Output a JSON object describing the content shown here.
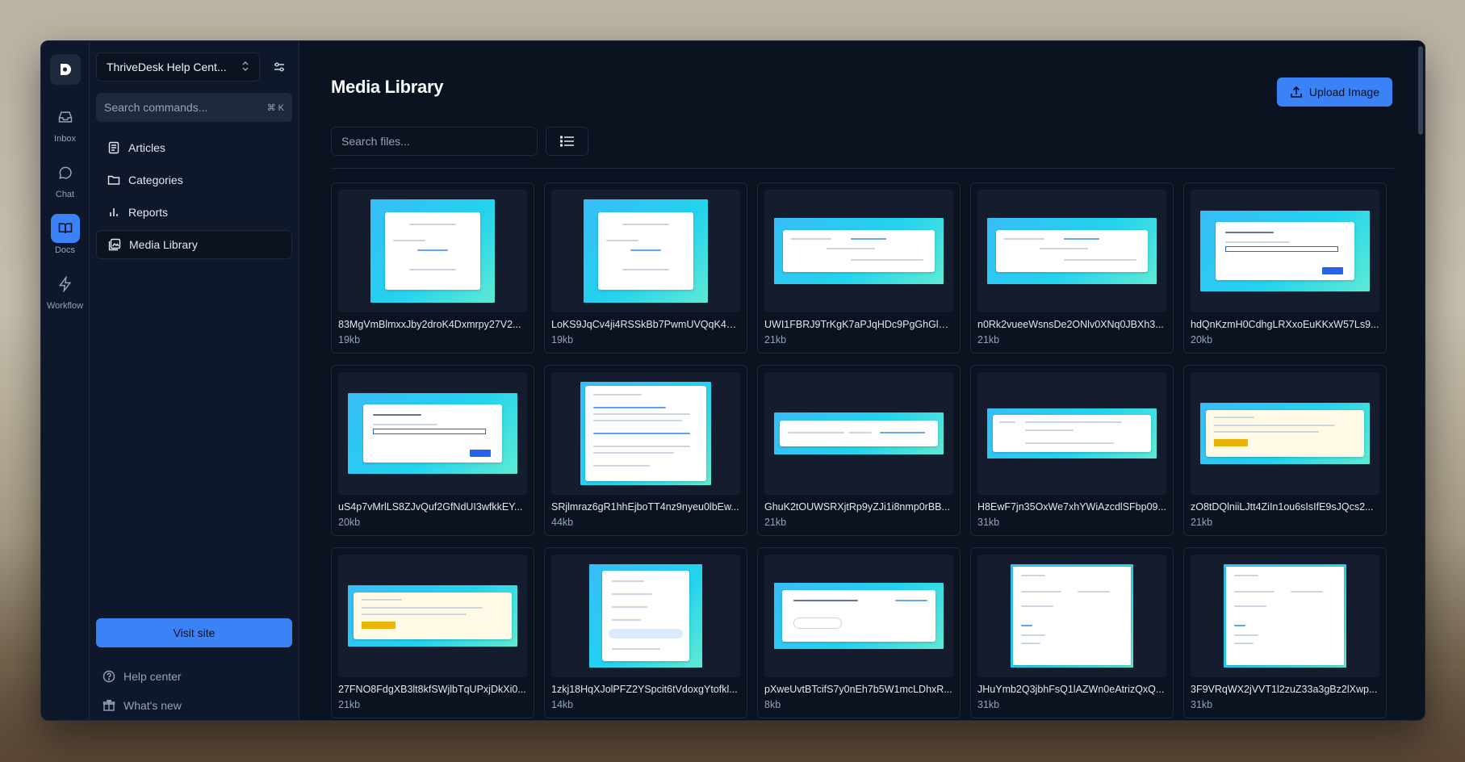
{
  "workspace": {
    "name": "ThriveDesk Help Cent..."
  },
  "rail": [
    {
      "label": "Inbox",
      "icon": "inbox-icon"
    },
    {
      "label": "Chat",
      "icon": "chat-icon"
    },
    {
      "label": "Docs",
      "icon": "book-icon"
    },
    {
      "label": "Workflow",
      "icon": "lightning-icon"
    }
  ],
  "sidebar": {
    "search_placeholder": "Search commands...",
    "search_shortcut": "⌘ K",
    "nav": [
      {
        "label": "Articles",
        "icon": "article-icon"
      },
      {
        "label": "Categories",
        "icon": "folder-icon"
      },
      {
        "label": "Reports",
        "icon": "bar-chart-icon"
      },
      {
        "label": "Media Library",
        "icon": "image-library-icon"
      }
    ],
    "visit_label": "Visit site",
    "help_label": "Help center",
    "whats_new_label": "What's new"
  },
  "main": {
    "title": "Media Library",
    "upload_label": "Upload Image",
    "search_placeholder": "Search files..."
  },
  "colors": {
    "accent": "#3b82f6",
    "background": "#0b1220",
    "panel": "#0f172a"
  },
  "files": [
    {
      "name": "83MgVmBlmxxJby2droK4Dxmrpy27V2...",
      "size": "19kb"
    },
    {
      "name": "LoKS9JqCv4ji4RSSkBb7PwmUVQqK4N...",
      "size": "19kb"
    },
    {
      "name": "UWI1FBRJ9TrKgK7aPJqHDc9PgGhGlYu...",
      "size": "21kb"
    },
    {
      "name": "n0Rk2vueeWsnsDe2ONlv0XNq0JBXh3...",
      "size": "21kb"
    },
    {
      "name": "hdQnKzmH0CdhgLRXxoEuKKxW57Ls9...",
      "size": "20kb"
    },
    {
      "name": "uS4p7vMrlLS8ZJvQuf2GfNdUI3wfkkEY...",
      "size": "20kb"
    },
    {
      "name": "SRjlmraz6gR1hhEjboTT4nz9nyeu0lbEw...",
      "size": "44kb"
    },
    {
      "name": "GhuK2tOUWSRXjtRp9yZJi1i8nmp0rBB...",
      "size": "21kb"
    },
    {
      "name": "H8EwF7jn35OxWe7xhYWiAzcdlSFbp09...",
      "size": "31kb"
    },
    {
      "name": "zO8tDQlniiLJtt4ZiIn1ou6sIsIfE9sJQcs2...",
      "size": "21kb"
    },
    {
      "name": "27FNO8FdgXB3lt8kfSWjlbTqUPxjDkXi0...",
      "size": "21kb"
    },
    {
      "name": "1zkj18HqXJolPFZ2YSpcit6tVdoxgYtofkl...",
      "size": "14kb"
    },
    {
      "name": "pXweUvtBTcifS7y0nEh7b5W1mcLDhxR...",
      "size": "8kb"
    },
    {
      "name": "JHuYmb2Q3jbhFsQ1lAZWn0eAtrizQxQ...",
      "size": "31kb"
    },
    {
      "name": "3F9VRqWX2jVVT1l2zuZ33a3gBz2lXwp...",
      "size": "31kb"
    }
  ]
}
